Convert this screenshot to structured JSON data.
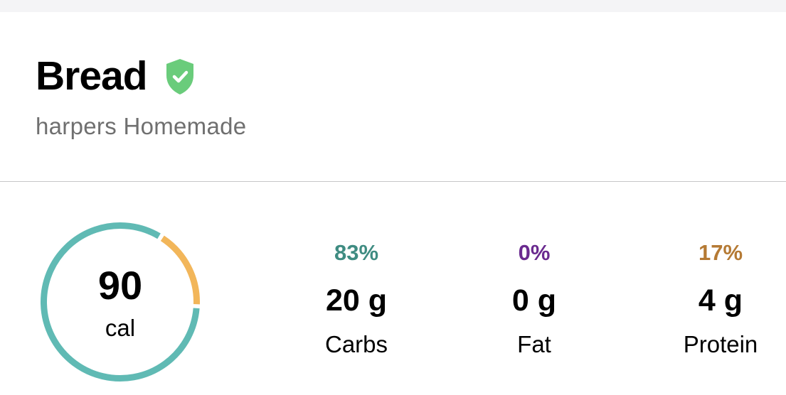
{
  "food": {
    "name": "Bread",
    "brand": "harpers Homemade",
    "verified_icon": "verified-shield-icon",
    "verified_color": "#6acc7b"
  },
  "calories": {
    "value": "90",
    "unit": "cal"
  },
  "ring": {
    "carbs_fraction": 0.83,
    "fat_fraction": 0.0,
    "protein_fraction": 0.17,
    "carbs_color": "#60bab4",
    "fat_color": "#6a2a8f",
    "protein_color": "#f2b65a"
  },
  "macros": [
    {
      "percent": "83%",
      "grams": "20 g",
      "label": "Carbs",
      "color": "#3f8c82"
    },
    {
      "percent": "0%",
      "grams": "0 g",
      "label": "Fat",
      "color": "#6a2a8f"
    },
    {
      "percent": "17%",
      "grams": "4 g",
      "label": "Protein",
      "color": "#b57a34"
    }
  ]
}
